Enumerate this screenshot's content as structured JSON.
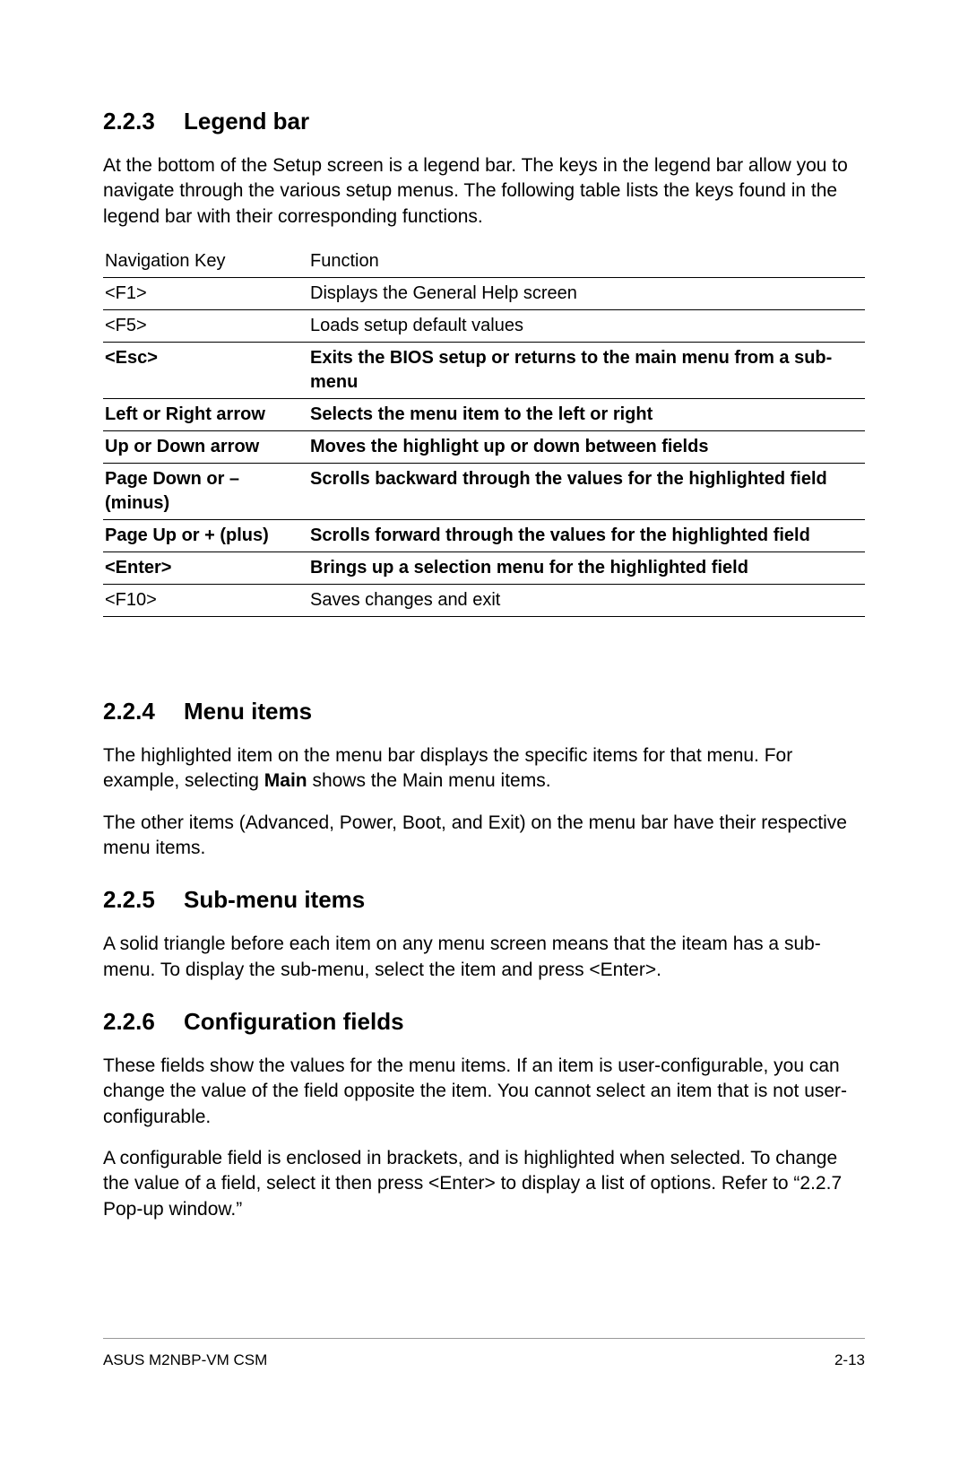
{
  "sections": {
    "s223": {
      "num": "2.2.3",
      "title": "Legend bar",
      "intro": "At the bottom of the Setup screen is a legend bar. The keys in the legend bar allow you to navigate through the various setup menus. The following table lists the keys found in the legend bar with their corresponding functions."
    },
    "s224": {
      "num": "2.2.4",
      "title": "Menu items",
      "p1a": "The highlighted item on the menu bar  displays the specific items for that menu. For example, selecting ",
      "p1bold": "Main",
      "p1b": " shows the Main menu items.",
      "p2": "The other items (Advanced, Power, Boot, and Exit) on the menu bar have their respective menu items."
    },
    "s225": {
      "num": "2.2.5",
      "title": "Sub-menu items",
      "p1": "A solid triangle before each item on any menu screen means that the iteam has a sub-menu. To display the sub-menu, select the item and press <Enter>."
    },
    "s226": {
      "num": "2.2.6",
      "title": "Configuration fields",
      "p1": "These fields show the values for the menu items. If an item is user-configurable, you can change the value of the field opposite the item. You cannot select an item that is not user-configurable.",
      "p2": "A configurable field is enclosed in brackets, and is highlighted when selected. To change the value of a field, select it then press <Enter> to display a list of options. Refer to “2.2.7 Pop-up window.”"
    }
  },
  "table": {
    "header": {
      "key": "Navigation Key",
      "func": "Function"
    },
    "rows": [
      {
        "key": "<F1>",
        "func": "Displays the General Help screen",
        "bold": false
      },
      {
        "key": "<F5>",
        "func": "Loads setup default values",
        "bold": false
      },
      {
        "key": "<Esc>",
        "func": "Exits the BIOS setup or returns to the main menu from a sub-menu",
        "bold": true
      },
      {
        "key": "Left or Right arrow",
        "func": "Selects the menu item to the left or right",
        "bold": true
      },
      {
        "key": "Up or Down arrow",
        "func": "Moves the highlight up or down between fields",
        "bold": true
      },
      {
        "key": "Page Down or – (minus)",
        "func": "Scrolls backward through the values for the highlighted field",
        "bold": true
      },
      {
        "key": "Page Up or + (plus)",
        "func": "Scrolls forward through the values for the highlighted field",
        "bold": true
      },
      {
        "key": "<Enter>",
        "func": "Brings up a selection menu for the highlighted field",
        "bold": true
      },
      {
        "key": "<F10>",
        "func": "Saves changes and exit",
        "bold": false
      }
    ]
  },
  "footer": {
    "left": "ASUS M2NBP-VM CSM",
    "right": "2-13"
  }
}
